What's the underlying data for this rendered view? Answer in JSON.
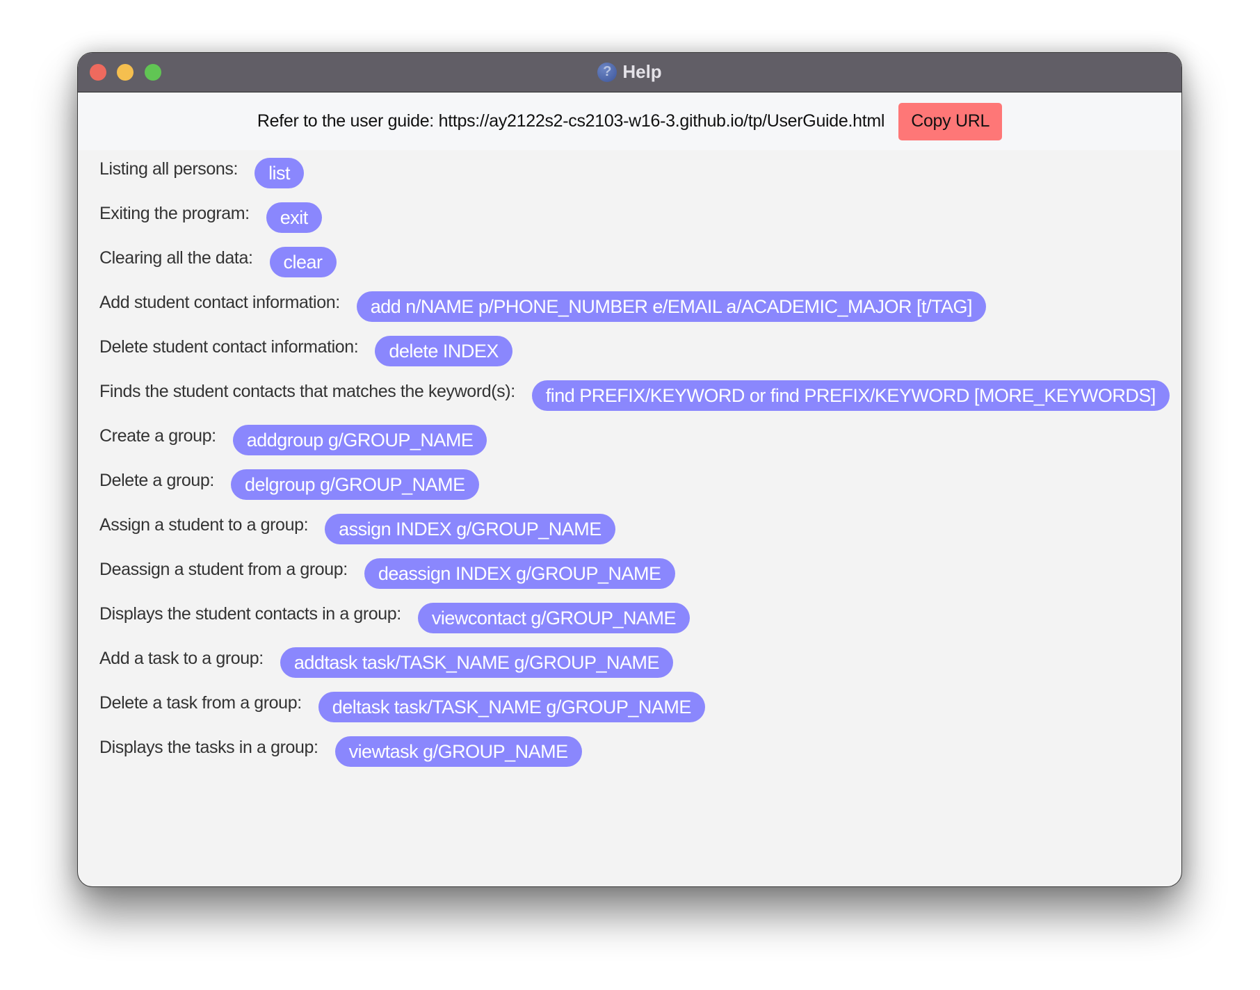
{
  "window": {
    "title": "Help",
    "title_icon": "help-question-icon"
  },
  "header": {
    "guide_text": "Refer to the user guide: https://ay2122s2-cs2103-w16-3.github.io/tp/UserGuide.html",
    "copy_button": "Copy URL"
  },
  "colors": {
    "pill_bg": "#8a87fd",
    "copy_button_bg": "#fe7777",
    "titlebar_bg": "#615e66"
  },
  "commands": [
    {
      "label": "Listing all persons:",
      "command": "list"
    },
    {
      "label": "Exiting the program:",
      "command": "exit"
    },
    {
      "label": "Clearing all the data:",
      "command": "clear"
    },
    {
      "label": "Add student contact information:",
      "command": "add n/NAME p/PHONE_NUMBER e/EMAIL a/ACADEMIC_MAJOR [t/TAG]"
    },
    {
      "label": "Delete student contact information:",
      "command": "delete INDEX"
    },
    {
      "label": "Finds the student contacts that matches the keyword(s):",
      "command": "find PREFIX/KEYWORD or find PREFIX/KEYWORD [MORE_KEYWORDS]"
    },
    {
      "label": "Create a group:",
      "command": "addgroup g/GROUP_NAME"
    },
    {
      "label": "Delete a group:",
      "command": "delgroup g/GROUP_NAME"
    },
    {
      "label": "Assign a student to a group:",
      "command": "assign INDEX g/GROUP_NAME"
    },
    {
      "label": "Deassign a student from a group:",
      "command": "deassign INDEX g/GROUP_NAME"
    },
    {
      "label": "Displays the student contacts in a group:",
      "command": "viewcontact g/GROUP_NAME"
    },
    {
      "label": "Add a task to a group:",
      "command": "addtask task/TASK_NAME g/GROUP_NAME"
    },
    {
      "label": "Delete a task from a group:",
      "command": "deltask task/TASK_NAME g/GROUP_NAME"
    },
    {
      "label": "Displays the tasks in a group:",
      "command": "viewtask g/GROUP_NAME"
    }
  ]
}
